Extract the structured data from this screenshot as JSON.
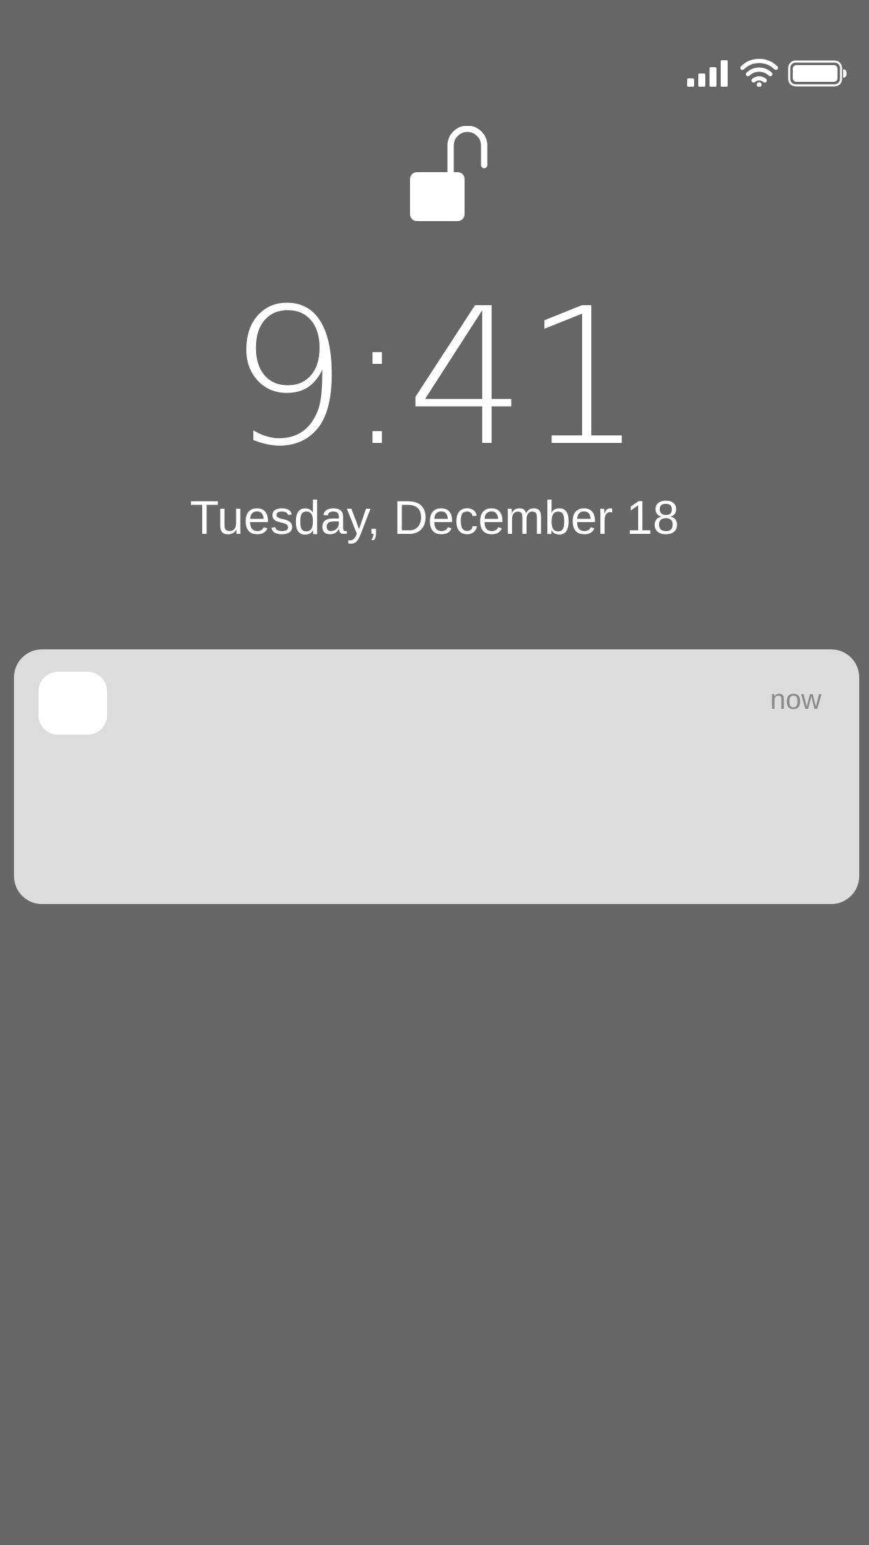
{
  "lock_screen": {
    "time": "9:41",
    "date": "Tuesday, December 18",
    "lock_state_icon": "unlocked-padlock-icon"
  },
  "status_bar": {
    "signal_icon": "cellular-signal-icon",
    "wifi_icon": "wifi-icon",
    "battery_icon": "battery-full-icon"
  },
  "notification": {
    "app_icon": "app-icon-placeholder",
    "timestamp": "now"
  },
  "colors": {
    "background": "#666666",
    "notification_bg": "#dcdcdc",
    "timestamp_text": "#8a8a8a",
    "foreground": "#ffffff"
  }
}
